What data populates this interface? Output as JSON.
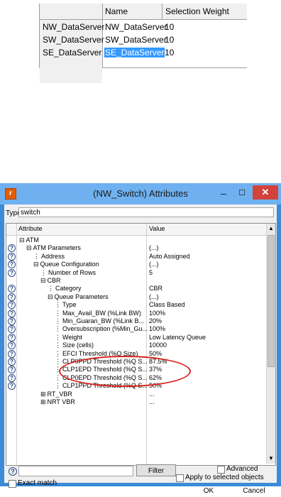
{
  "top_table": {
    "columns": [
      "Name",
      "Selection Weight"
    ],
    "rows": [
      {
        "header": "NW_DataServer",
        "name": "NW_DataServer",
        "weight": "10",
        "selected": false
      },
      {
        "header": "SW_DataServer",
        "name": "SW_DataServer",
        "weight": "10",
        "selected": false
      },
      {
        "header": "SE_DataServer",
        "name": "SE_DataServer",
        "weight": "10",
        "selected": true
      }
    ]
  },
  "dialog": {
    "title": "(NW_Switch) Attributes",
    "app_icon_glyph": "r",
    "minimize_glyph": "–",
    "maximize_glyph": "☐",
    "close_glyph": "✕",
    "type_label": "Type:",
    "type_value": "switch",
    "columns": {
      "attribute": "Attribute",
      "value": "Value"
    },
    "rows": [
      {
        "help": false,
        "indent": 0,
        "expander": "⊟",
        "label": "ATM",
        "value": ""
      },
      {
        "help": true,
        "indent": 1,
        "expander": "⊟",
        "label": "ATM Parameters",
        "value": "(...)"
      },
      {
        "help": true,
        "indent": 2,
        "expander": "",
        "label": "Address",
        "value": "Auto Assigned"
      },
      {
        "help": true,
        "indent": 2,
        "expander": "⊟",
        "label": "Queue Configuration",
        "value": "(...)"
      },
      {
        "help": true,
        "indent": 3,
        "expander": "",
        "label": "Number of Rows",
        "value": "5"
      },
      {
        "help": false,
        "indent": 3,
        "expander": "⊟",
        "label": "CBR",
        "value": ""
      },
      {
        "help": true,
        "indent": 4,
        "expander": "",
        "label": "Category",
        "value": "CBR"
      },
      {
        "help": true,
        "indent": 4,
        "expander": "⊟",
        "label": "Queue Parameters",
        "value": "(...)"
      },
      {
        "help": true,
        "indent": 5,
        "expander": "",
        "label": "Type",
        "value": "Class Based"
      },
      {
        "help": true,
        "indent": 5,
        "expander": "",
        "label": "Max_Avail_BW (%Link BW)",
        "value": "100%"
      },
      {
        "help": true,
        "indent": 5,
        "expander": "",
        "label": "Min_Guaran_BW (%Link B...",
        "value": "20%"
      },
      {
        "help": true,
        "indent": 5,
        "expander": "",
        "label": "Oversubscription (%Min_Gu...",
        "value": "100%"
      },
      {
        "help": true,
        "indent": 5,
        "expander": "",
        "label": "Weight",
        "value": "Low Latency Queue"
      },
      {
        "help": true,
        "indent": 5,
        "expander": "",
        "label": "Size (cells)",
        "value": "10000"
      },
      {
        "help": true,
        "indent": 5,
        "expander": "",
        "label": "EFCI Threshold (%Q Size)",
        "value": "50%"
      },
      {
        "help": true,
        "indent": 5,
        "expander": "",
        "label": "CLP0PPD Threshold (%Q S...",
        "value": "87.5%"
      },
      {
        "help": true,
        "indent": 5,
        "expander": "",
        "label": "CLP1EPD Threshold (%Q S...",
        "value": "37%"
      },
      {
        "help": true,
        "indent": 5,
        "expander": "",
        "label": "CLP0EPD Threshold (%Q S...",
        "value": "62%"
      },
      {
        "help": true,
        "indent": 5,
        "expander": "",
        "label": "CLP1PPD Threshold (%Q S...",
        "value": "50%"
      },
      {
        "help": false,
        "indent": 3,
        "expander": "⊞",
        "label": "RT_VBR",
        "value": "..."
      },
      {
        "help": false,
        "indent": 3,
        "expander": "⊞",
        "label": "NRT VBR",
        "value": "..."
      }
    ],
    "find_value": "",
    "filter_label": "Filter",
    "exact_match_label": "Exact match",
    "advanced_label": "Advanced",
    "apply_label": "Apply to selected objects",
    "ok_label": "OK",
    "cancel_label": "Cancel",
    "help_glyph": "?",
    "scroll_up_glyph": "▲",
    "scroll_down_glyph": "▼",
    "highlight_color": "#d9261c",
    "selection_color": "#3399ff"
  }
}
